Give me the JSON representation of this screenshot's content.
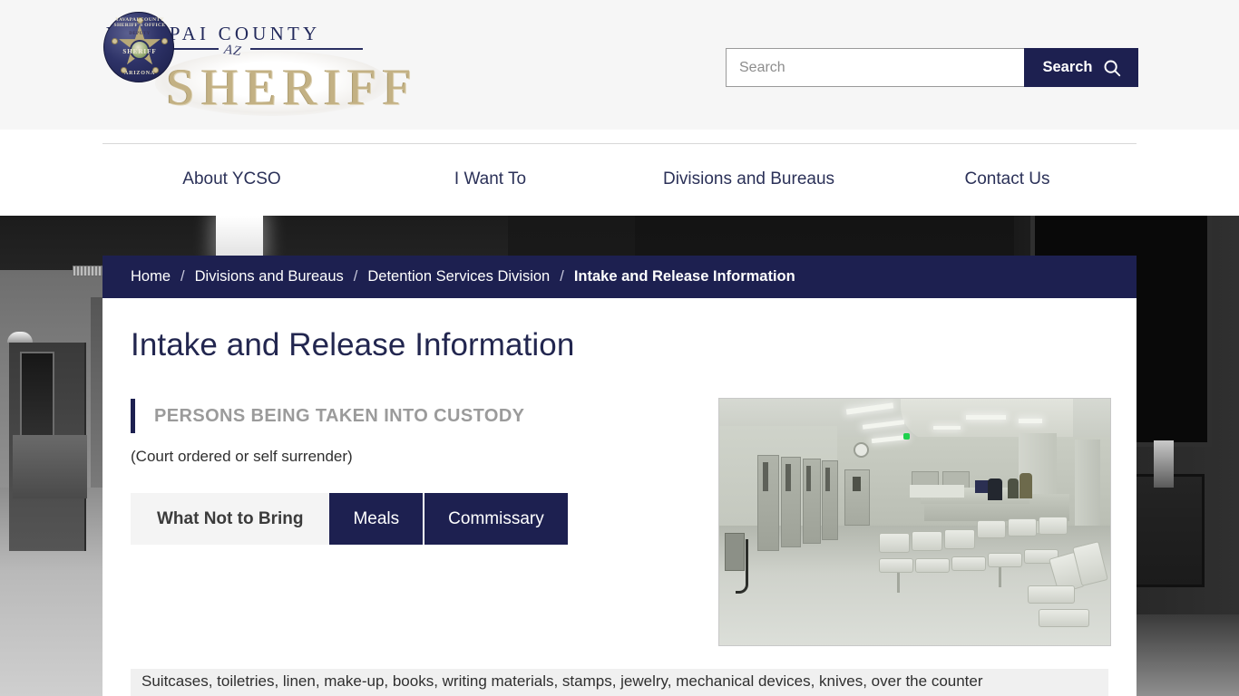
{
  "site": {
    "logo": {
      "line1": "YAVAPAI  COUNTY",
      "state_mark": "AZ",
      "wordmark": "SHERIFF",
      "badge_top": "YAVAPAI COUNTY SHERIFF'S OFFICE",
      "badge_mid": "SHERIFF",
      "badge_bottom": "ARIZONA",
      "badge_deputy": "DEPUTY"
    }
  },
  "search": {
    "placeholder": "Search",
    "value": "",
    "button_label": "Search",
    "icon": "search-icon"
  },
  "nav": {
    "items": [
      {
        "label": "About YCSO"
      },
      {
        "label": "I Want To"
      },
      {
        "label": "Divisions and Bureaus"
      },
      {
        "label": "Contact Us"
      }
    ]
  },
  "breadcrumb": {
    "separator": "/",
    "items": [
      {
        "label": "Home",
        "current": false
      },
      {
        "label": "Divisions and Bureaus",
        "current": false
      },
      {
        "label": "Detention Services Division",
        "current": false
      },
      {
        "label": "Intake and Release Information",
        "current": true
      }
    ]
  },
  "page": {
    "title": "Intake and Release Information",
    "section_heading": "PERSONS BEING TAKEN INTO CUSTODY",
    "section_note": "(Court ordered or self surrender)",
    "tabs": [
      {
        "label": "What Not to Bring",
        "active": true
      },
      {
        "label": "Meals",
        "active": false
      },
      {
        "label": "Commissary",
        "active": false
      }
    ],
    "panel_text": "Suitcases, toiletries, linen, make-up, books, writing materials, stamps, jewelry, mechanical devices, knives, over the counter",
    "photo_alt": "jail-intake-lobby-photo"
  },
  "colors": {
    "navy": "#1d2050",
    "gold": "#c3b184",
    "panel_gray": "#f0f0f0",
    "header_gray": "#f6f6f6",
    "muted_heading": "#9b9b9b"
  }
}
